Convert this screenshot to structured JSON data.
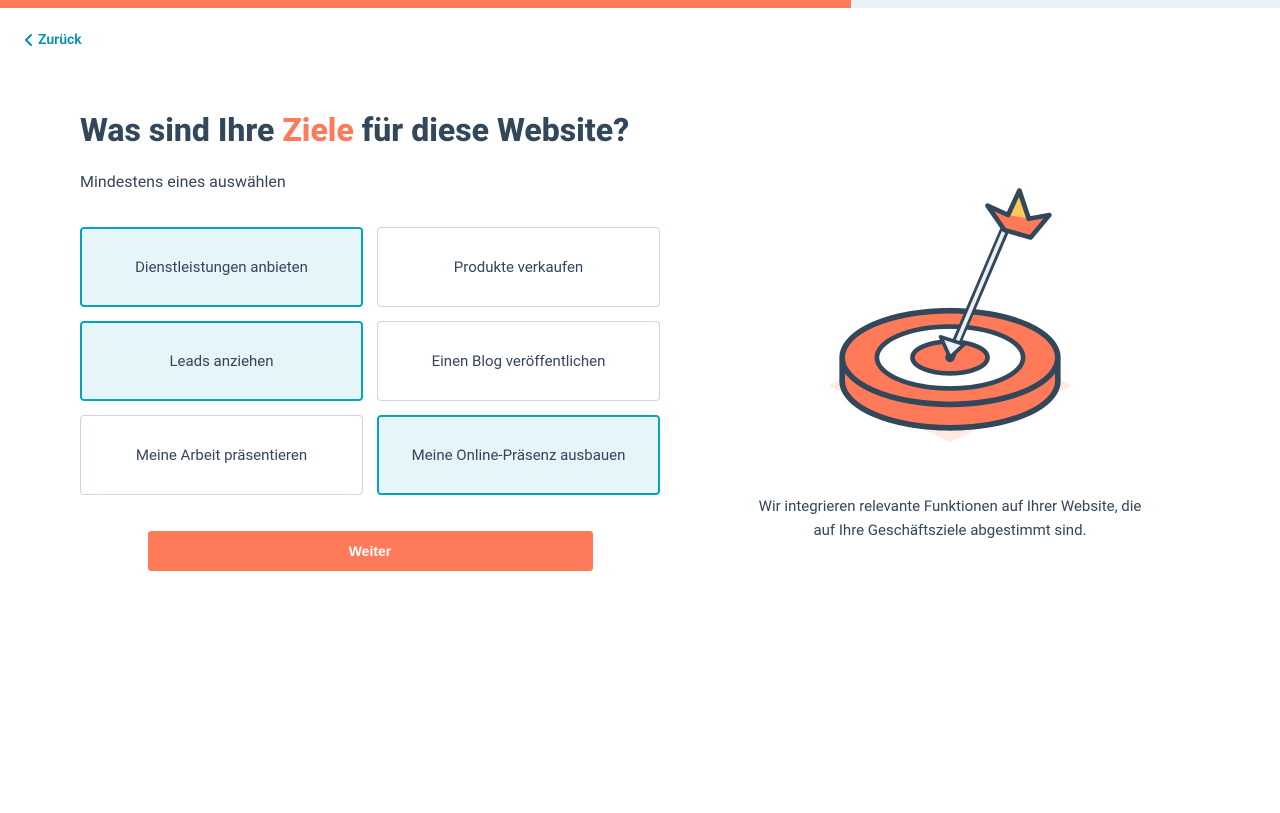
{
  "nav": {
    "back_label": "Zurück"
  },
  "heading": {
    "prefix": "Was sind Ihre ",
    "highlight": "Ziele",
    "suffix": " für diese Website?"
  },
  "subtitle": "Mindestens eines auswählen",
  "options": [
    {
      "label": "Dienstleistungen anbieten",
      "selected": true
    },
    {
      "label": "Produkte verkaufen",
      "selected": false
    },
    {
      "label": "Leads anziehen",
      "selected": true
    },
    {
      "label": "Einen Blog veröffentlichen",
      "selected": false
    },
    {
      "label": "Meine Arbeit präsentieren",
      "selected": false
    },
    {
      "label": "Meine Online-Präsenz ausbauen",
      "selected": true
    }
  ],
  "continue_label": "Weiter",
  "description": "Wir integrieren relevante Funktionen auf Ihrer Website, die auf Ihre Geschäftsziele abgestimmt sind.",
  "progress_percent": 66.5
}
